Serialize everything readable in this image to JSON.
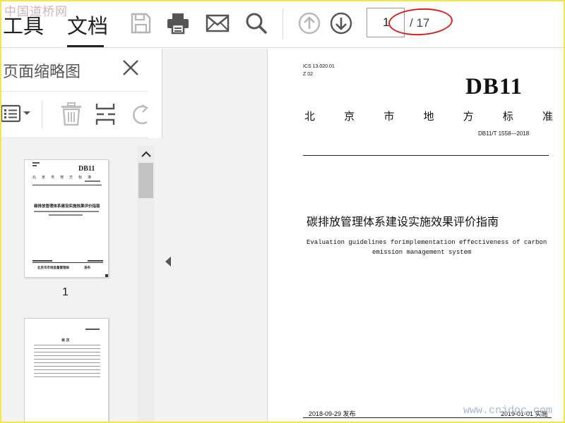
{
  "watermark_top": "中国道桥网",
  "watermark_bottom": "www.cnjdoc.com",
  "toolbar": {
    "tabs": [
      "工具",
      "文档"
    ],
    "active_tab": "文档",
    "icons": [
      "save-icon",
      "print-icon",
      "mail-icon",
      "search-icon",
      "page-up-icon",
      "page-down-icon"
    ],
    "page_current": "1",
    "page_total": "/ 17"
  },
  "sidebar": {
    "title": "页面缩略图",
    "tool_icons": [
      "thumbnail-options-icon",
      "delete-icon",
      "insert-page-icon",
      "rotate-icon"
    ],
    "thumbnails": [
      {
        "page_label": "1"
      },
      {
        "page_label": ""
      }
    ]
  },
  "thumbnail1": {
    "db11": "DB11",
    "city_std": "北京市地方标准",
    "title": "碳排放管理体系建设实施效果评价指南",
    "footer_left": "北京市市场监督管理局",
    "footer_right": "发布"
  },
  "thumbnail2": {
    "heading": "目 次"
  },
  "document": {
    "ics": "ICS   13.020.01",
    "z_code": "Z  02",
    "db11": "DB11",
    "standard_chars": [
      "北",
      "京",
      "市",
      "地",
      "方",
      "标",
      "准"
    ],
    "std_code": "DB11/T 1558—2018",
    "title_cn": "碳排放管理体系建设实施效果评价指南",
    "title_en_line1": "Evaluation guidelines forimplementation effectiveness of carbon",
    "title_en_line2": "emission management system",
    "publish_date": "2018-09-29 发布",
    "implement_date": "2019-01-01 实施"
  },
  "colors": {
    "frame_border": "#f2e64a",
    "annotation_ellipse": "#d8211a"
  }
}
